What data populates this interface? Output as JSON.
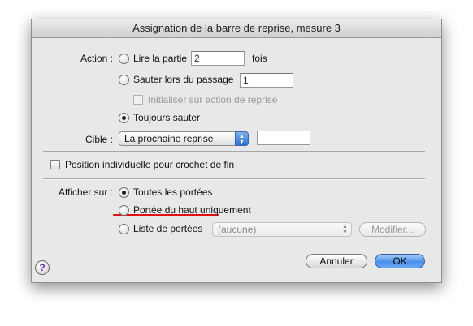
{
  "dialog": {
    "title": "Assignation de la barre de reprise, mesure 3",
    "action_label": "Action :",
    "lire_label": "Lire la partie",
    "lire_value": "2",
    "fois_label": "fois",
    "sauter_label": "Sauter lors du passage",
    "sauter_value": "1",
    "init_label": "Initialiser sur action de reprise",
    "toujours_label": "Toujours sauter",
    "cible_label": "Cible :",
    "cible_value": "La prochaine reprise",
    "cible_field": "",
    "position_label": "Position individuelle pour crochet de fin",
    "afficher_label": "Afficher sur :",
    "toutes_label": "Toutes les portées",
    "haut_label": "Portée du haut uniquement",
    "liste_label": "Liste de portées",
    "liste_value": "(aucune)",
    "modifier_label": "Modifier...",
    "annuler_label": "Annuler",
    "ok_label": "OK",
    "help_glyph": "?"
  },
  "state": {
    "action_selected": "toujours_sauter",
    "afficher_selected": "toutes_les_portees"
  },
  "colors": {
    "annotation_underline": "#e01010",
    "default_button": "#4a8fe8"
  }
}
